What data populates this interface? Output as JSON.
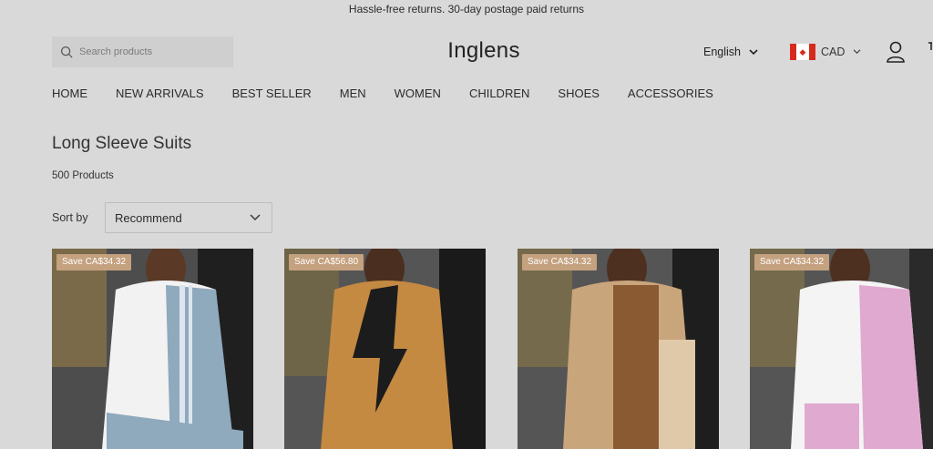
{
  "announcement": "Hassle-free returns. 30-day postage paid returns",
  "search": {
    "placeholder": "Search products",
    "icon": "search-icon"
  },
  "brand": "Inglens",
  "language": "English",
  "currency": {
    "code": "CAD",
    "flag": "canada-flag"
  },
  "nav": [
    "HOME",
    "NEW ARRIVALS",
    "BEST SELLER",
    "MEN",
    "WOMEN",
    "CHILDREN",
    "SHOES",
    "ACCESSORIES"
  ],
  "collection": {
    "title": "Long Sleeve Suits",
    "count": "500 Products"
  },
  "sort": {
    "label": "Sort by",
    "value": "Recommend"
  },
  "products": [
    {
      "badge": "Save CA$34.32",
      "colors": {
        "main": "#f2f2f2",
        "accent": "#8fa9bd"
      }
    },
    {
      "badge": "Save CA$56.80",
      "colors": {
        "main": "#c48a42",
        "accent": "#1c1c1c"
      }
    },
    {
      "badge": "Save CA$34.32",
      "colors": {
        "main": "#c9a57c",
        "accent": "#8a5a33"
      }
    },
    {
      "badge": "Save CA$34.32",
      "colors": {
        "main": "#f4f4f4",
        "accent": "#e0a9cf"
      }
    }
  ]
}
